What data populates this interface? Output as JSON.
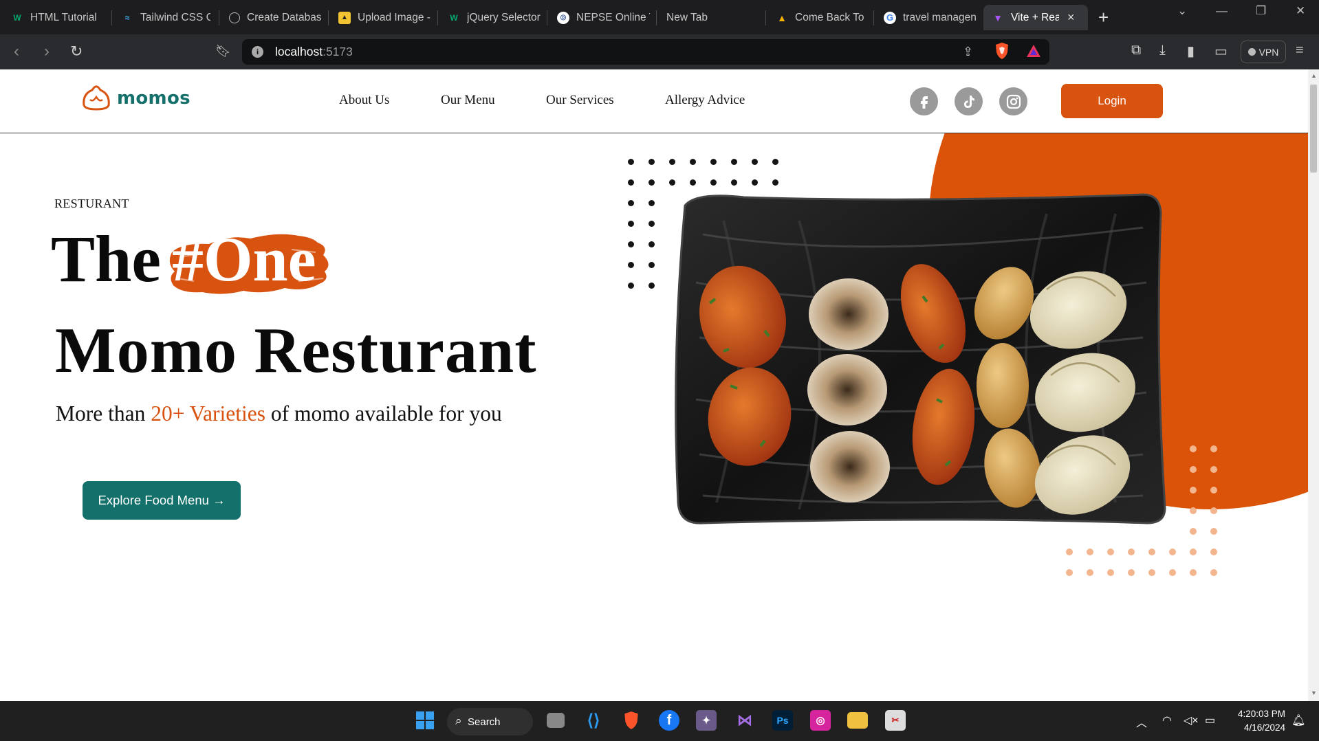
{
  "browser": {
    "tabs": [
      {
        "label": "HTML Tutorial",
        "icon": "w3schools-icon"
      },
      {
        "label": "Tailwind CSS Cc",
        "icon": "tailwind-icon"
      },
      {
        "label": "Create Databas",
        "icon": "openai-icon"
      },
      {
        "label": "Upload Image -",
        "icon": "upload-icon"
      },
      {
        "label": "jQuery Selector",
        "icon": "w3schools-icon"
      },
      {
        "label": "NEPSE Online T",
        "icon": "nepse-icon"
      },
      {
        "label": "New Tab",
        "icon": ""
      },
      {
        "label": "Come Back To I",
        "icon": "drive-icon"
      },
      {
        "label": "travel managen",
        "icon": "google-icon"
      },
      {
        "label": "Vite + Rea",
        "icon": "vite-icon",
        "active": true
      }
    ],
    "url_host": "localhost",
    "url_port": ":5173",
    "vpn_label": "VPN",
    "colors": {
      "chrome_bg": "#1d1d1f",
      "toolbar_bg": "#2a2b2e",
      "brave": "#fb542b"
    }
  },
  "site": {
    "brand": "momos",
    "nav": [
      "About Us",
      "Our Menu",
      "Our Services",
      "Allergy Advice"
    ],
    "social": [
      "facebook-icon",
      "tiktok-icon",
      "instagram-icon"
    ],
    "login_label": "Login",
    "hero": {
      "eyebrow": "RESTURANT",
      "the": "The",
      "highlight": "#One",
      "title": "Momo Resturant",
      "sub_before": "More than ",
      "sub_highlight": "20+ Varieties",
      "sub_after": " of momo available for you",
      "cta_label": "Explore Food Menu →"
    },
    "colors": {
      "accent": "#d95310",
      "teal": "#14706b",
      "circle": "#db5309"
    }
  },
  "taskbar": {
    "search_label": "Search",
    "time": "4:20:03 PM",
    "date": "4/16/2024"
  }
}
